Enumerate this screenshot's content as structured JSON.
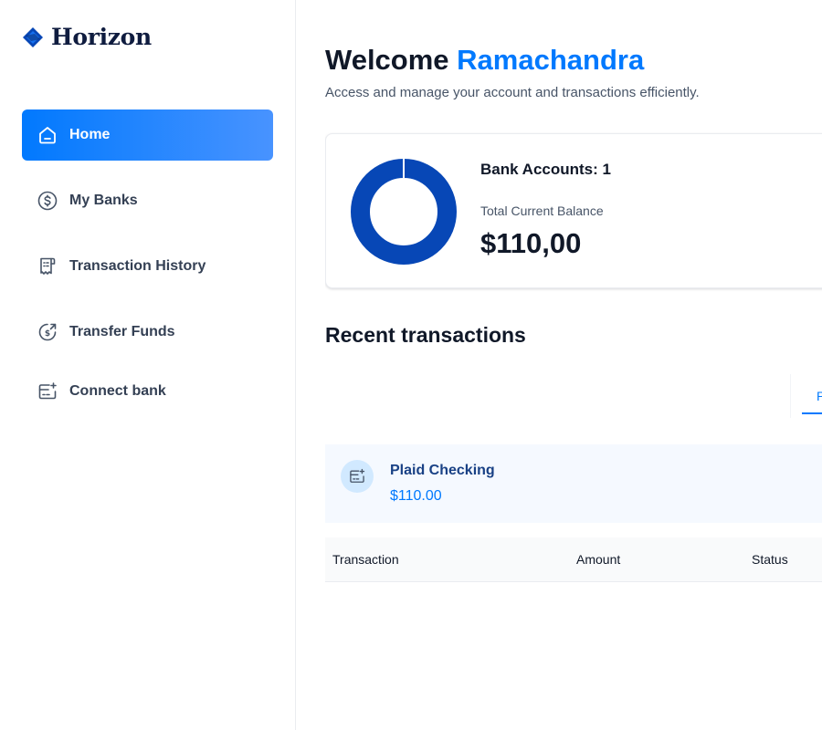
{
  "brand": {
    "name": "Horizon"
  },
  "sidebar": {
    "items": [
      {
        "label": "Home",
        "icon": "home-icon",
        "active": true
      },
      {
        "label": "My Banks",
        "icon": "dollar-circle-icon",
        "active": false
      },
      {
        "label": "Transaction History",
        "icon": "receipt-icon",
        "active": false
      },
      {
        "label": "Transfer Funds",
        "icon": "money-send-icon",
        "active": false
      },
      {
        "label": "Connect bank",
        "icon": "card-add-icon",
        "active": false
      }
    ]
  },
  "header": {
    "greeting": "Welcome",
    "user_name": "Ramachandra",
    "subtitle": "Access and manage your account and transactions efficiently."
  },
  "balance_card": {
    "accounts_label": "Bank Accounts: 1",
    "total_label": "Total Current Balance",
    "total_value": "$110,00",
    "donut_color": "#0747b6"
  },
  "recent": {
    "title": "Recent transactions",
    "tab_label": "P",
    "account": {
      "name": "Plaid Checking",
      "balance": "$110.00"
    },
    "table": {
      "columns": [
        "Transaction",
        "Amount",
        "Status"
      ]
    }
  },
  "colors": {
    "accent": "#0179fe",
    "accent_dark": "#194185",
    "panel_bg": "#f5f9ff"
  }
}
